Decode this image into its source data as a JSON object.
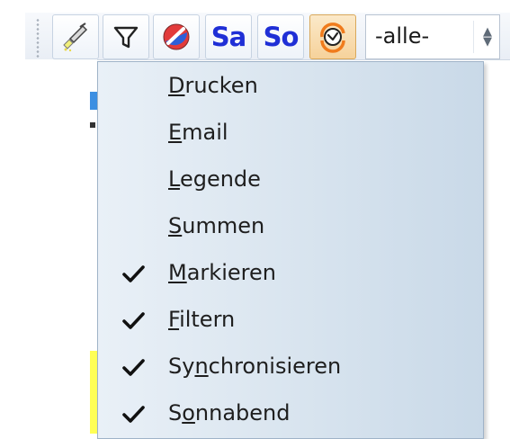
{
  "toolbar": {
    "buttons": [
      {
        "name": "brush-icon"
      },
      {
        "name": "filter-icon"
      },
      {
        "name": "color-sync-icon"
      },
      {
        "label": "Sa"
      },
      {
        "label": "So"
      },
      {
        "name": "clock-refresh-icon",
        "selected": true
      }
    ],
    "select_value": "-alle-"
  },
  "menu": {
    "items": [
      {
        "accel": "D",
        "rest": "rucken",
        "checked": false
      },
      {
        "accel": "E",
        "rest": "mail",
        "checked": false
      },
      {
        "accel": "L",
        "rest": "egende",
        "checked": false
      },
      {
        "accel": "S",
        "rest": "ummen",
        "checked": false
      },
      {
        "accel": "M",
        "rest": "arkieren",
        "checked": true
      },
      {
        "accel": "F",
        "rest": "iltern",
        "checked": true
      },
      {
        "pre": "Sy",
        "accel": "n",
        "rest": "chronisieren",
        "checked": true
      },
      {
        "pre": "S",
        "accel": "o",
        "rest": "nnabend",
        "checked": true
      }
    ]
  },
  "colors": {
    "accent_text": "#1f2fd6",
    "selected_button": "#f6d29b",
    "yellow_highlight": "#ffff55"
  }
}
